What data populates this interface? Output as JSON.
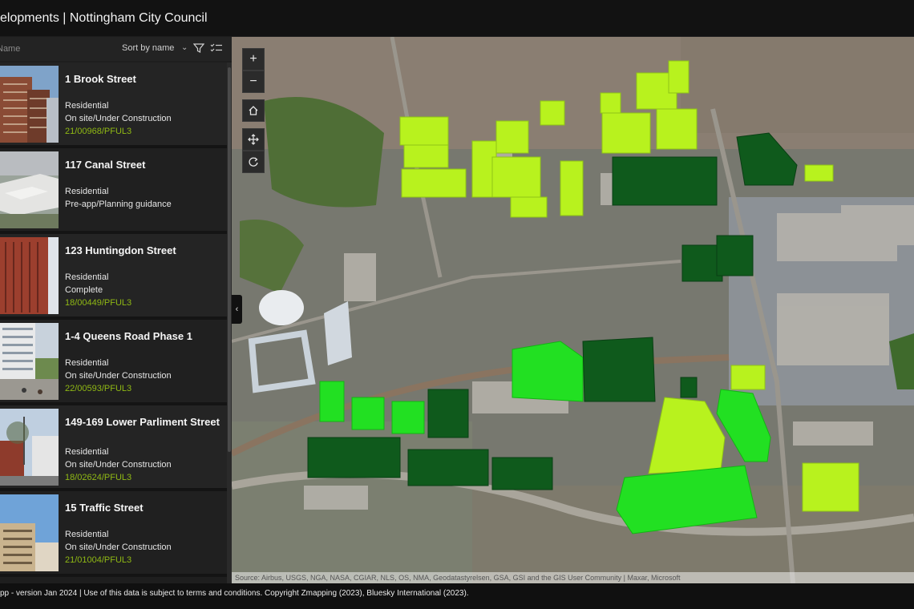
{
  "app": {
    "title": "elopments | Nottingham City Council"
  },
  "search": {
    "placeholder": "Name"
  },
  "sort": {
    "label": "Sort by name",
    "chevron": "chevron-down-icon"
  },
  "toolbar_icons": [
    "filter-icon",
    "checklist-icon"
  ],
  "developments": [
    {
      "title": "1 Brook Street",
      "type": "Residential",
      "status": "On site/Under Construction",
      "ref": "21/00968/PFUL3"
    },
    {
      "title": "117 Canal Street",
      "type": "Residential",
      "status": "Pre-app/Planning guidance",
      "ref": ""
    },
    {
      "title": "123 Huntingdon Street",
      "type": "Residential",
      "status": "Complete",
      "ref": "18/00449/PFUL3"
    },
    {
      "title": "1-4 Queens Road Phase 1",
      "type": "Residential",
      "status": "On site/Under Construction",
      "ref": "22/00593/PFUL3"
    },
    {
      "title": "149-169 Lower Parliment Street",
      "type": "Residential",
      "status": "On site/Under Construction",
      "ref": "18/02624/PFUL3"
    },
    {
      "title": "15 Traffic Street",
      "type": "Residential",
      "status": "On site/Under Construction",
      "ref": "21/01004/PFUL3"
    }
  ],
  "map": {
    "controls": [
      "zoom-in-icon",
      "zoom-out-icon",
      "home-icon",
      "pan-icon",
      "rotate-icon"
    ],
    "attribution": "Source: Airbus, USGS, NGA, NASA, CGIAR, NLS, OS, NMA, Geodatastyrelsen, GSA, GSI and the GIS User Community  |  Maxar, Microsoft",
    "colors": {
      "complete": "#0f5a1c",
      "construction": "#22e022",
      "planning": "#b8f21e"
    }
  },
  "footer": {
    "text": "pp - version Jan 2024 | Use of this data is subject to terms and conditions. Copyright Zmapping (2023), Bluesky International (2023)."
  }
}
